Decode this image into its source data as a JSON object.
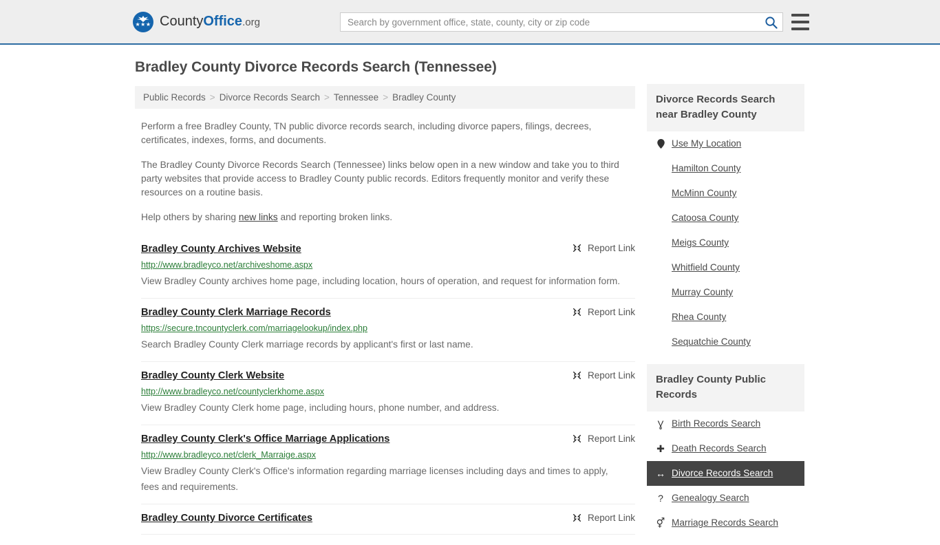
{
  "header": {
    "brand": {
      "part1": "County",
      "part2": "Office",
      "part3": ".org",
      "logo_icon": "eagle-stars-emblem",
      "stars": "★★★"
    },
    "search": {
      "placeholder": "Search by government office, state, county, city or zip code",
      "value": "",
      "icon": "search-icon"
    },
    "menu": {
      "icon": "hamburger-menu-icon",
      "label": "Menu"
    },
    "accent_color": "#2d6ca2",
    "background_color": "#eeeeee"
  },
  "main": {
    "title": "Bradley County Divorce Records Search (Tennessee)",
    "breadcrumb": [
      {
        "label": "Public Records"
      },
      {
        "label": "Divorce Records Search"
      },
      {
        "label": "Tennessee"
      },
      {
        "label": "Bradley County"
      }
    ],
    "breadcrumb_separator": ">",
    "intro": {
      "p1": "Perform a free Bradley County, TN public divorce records search, including divorce papers, filings, decrees, certificates, indexes, forms, and documents.",
      "p2": "The Bradley County Divorce Records Search (Tennessee) links below open in a new window and take you to third party websites that provide access to Bradley County public records. Editors frequently monitor and verify these resources on a routine basis.",
      "p3_before": "Help others by sharing ",
      "p3_link": "new links",
      "p3_after": " and reporting broken links."
    },
    "report_link_label": "Report Link",
    "report_link_icon": "broken-link-icon",
    "results": [
      {
        "title": "Bradley County Archives Website",
        "url": "http://www.bradleyco.net/archiveshome.aspx",
        "description": "View Bradley County archives home page, including location, hours of operation, and request for information form."
      },
      {
        "title": "Bradley County Clerk Marriage Records",
        "url": "https://secure.tncountyclerk.com/marriagelookup/index.php",
        "description": "Search Bradley County Clerk marriage records by applicant's first or last name."
      },
      {
        "title": "Bradley County Clerk Website",
        "url": "http://www.bradleyco.net/countyclerkhome.aspx",
        "description": "View Bradley County Clerk home page, including hours, phone number, and address."
      },
      {
        "title": "Bradley County Clerk's Office Marriage Applications",
        "url": "http://www.bradleyco.net/clerk_Marraige.aspx",
        "description": "View Bradley County Clerk's Office's information regarding marriage licenses including days and times to apply, fees and requirements."
      },
      {
        "title": "Bradley County Divorce Certificates",
        "url": "",
        "description": ""
      }
    ]
  },
  "sidebar": {
    "nearby": {
      "heading": "Divorce Records Search near Bradley County",
      "items": [
        {
          "label": "Use My Location",
          "icon": "map-pin-icon",
          "glyph": "⬤"
        },
        {
          "label": "Hamilton County",
          "icon": "",
          "glyph": ""
        },
        {
          "label": "McMinn County",
          "icon": "",
          "glyph": ""
        },
        {
          "label": "Catoosa County",
          "icon": "",
          "glyph": ""
        },
        {
          "label": "Meigs County",
          "icon": "",
          "glyph": ""
        },
        {
          "label": "Whitfield County",
          "icon": "",
          "glyph": ""
        },
        {
          "label": "Murray County",
          "icon": "",
          "glyph": ""
        },
        {
          "label": "Rhea County",
          "icon": "",
          "glyph": ""
        },
        {
          "label": "Sequatchie County",
          "icon": "",
          "glyph": ""
        }
      ]
    },
    "public_records": {
      "heading": "Bradley County Public Records",
      "items": [
        {
          "label": "Birth Records Search",
          "icon": "baby-icon",
          "glyph": "Ɣ",
          "active": false
        },
        {
          "label": "Death Records Search",
          "icon": "cross-icon",
          "glyph": "✚",
          "active": false
        },
        {
          "label": "Divorce Records Search",
          "icon": "left-right-arrow-icon",
          "glyph": "↔",
          "active": true
        },
        {
          "label": "Genealogy Search",
          "icon": "question-mark-icon",
          "glyph": "?",
          "active": false
        },
        {
          "label": "Marriage Records Search",
          "icon": "male-female-icon",
          "glyph": "⚥",
          "active": false
        }
      ],
      "active_background": "#444444"
    }
  }
}
